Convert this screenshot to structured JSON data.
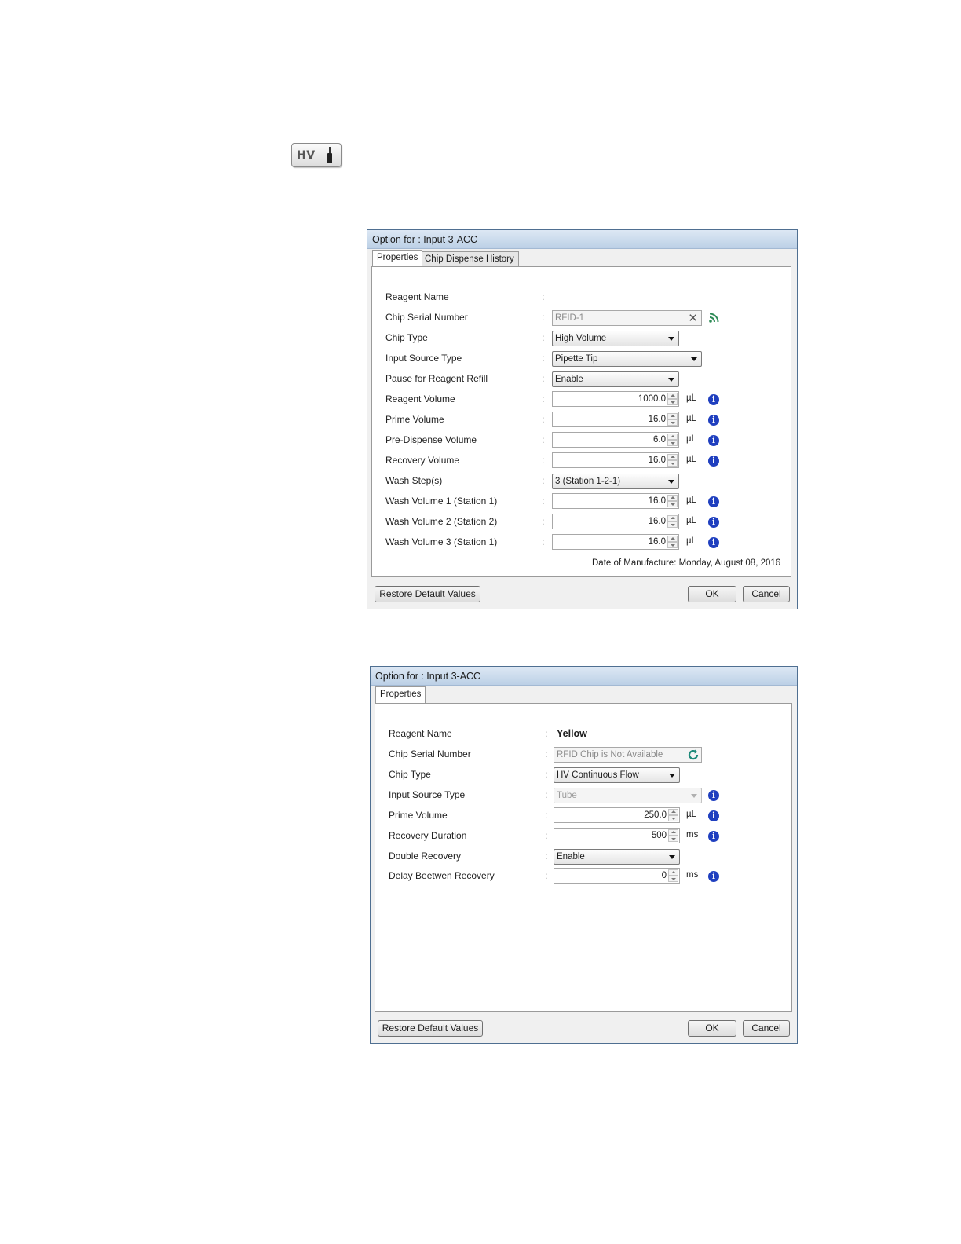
{
  "hv_button": {
    "label": "HV",
    "icon": "tube-icon"
  },
  "dialog1": {
    "title": "Option for : Input 3-ACC",
    "tabs": [
      "Properties",
      "Chip Dispense History"
    ],
    "reagent_name": {
      "label": "Reagent Name",
      "value": ""
    },
    "chip_serial": {
      "label": "Chip Serial Number",
      "value": "RFID-1"
    },
    "chip_type": {
      "label": "Chip Type",
      "value": "High Volume"
    },
    "input_source": {
      "label": "Input Source Type",
      "value": "Pipette Tip"
    },
    "pause_refill": {
      "label": "Pause for Reagent Refill",
      "value": "Enable"
    },
    "reagent_volume": {
      "label": "Reagent Volume",
      "value": "1000.0",
      "unit": "µL"
    },
    "prime_volume": {
      "label": "Prime Volume",
      "value": "16.0",
      "unit": "µL"
    },
    "predispense_volume": {
      "label": "Pre-Dispense Volume",
      "value": "6.0",
      "unit": "µL"
    },
    "recovery_volume": {
      "label": "Recovery Volume",
      "value": "16.0",
      "unit": "µL"
    },
    "wash_steps": {
      "label": "Wash Step(s)",
      "value": "3 (Station 1-2-1)"
    },
    "wash_volume_1": {
      "label": "Wash Volume 1 (Station 1)",
      "value": "16.0",
      "unit": "µL"
    },
    "wash_volume_2": {
      "label": "Wash Volume 2 (Station 2)",
      "value": "16.0",
      "unit": "µL"
    },
    "wash_volume_3": {
      "label": "Wash Volume 3 (Station 1)",
      "value": "16.0",
      "unit": "µL"
    },
    "date_of_manufacture": "Date of Manufacture: Monday, August 08, 2016",
    "buttons": {
      "restore": "Restore Default Values",
      "ok": "OK",
      "cancel": "Cancel"
    }
  },
  "dialog2": {
    "title": "Option for : Input 3-ACC",
    "tabs": [
      "Properties"
    ],
    "reagent_name": {
      "label": "Reagent Name",
      "value": "Yellow"
    },
    "chip_serial": {
      "label": "Chip Serial Number",
      "value": "RFID Chip is Not Available"
    },
    "chip_type": {
      "label": "Chip Type",
      "value": "HV Continuous Flow"
    },
    "input_source": {
      "label": "Input Source Type",
      "value": "Tube"
    },
    "prime_volume": {
      "label": "Prime Volume",
      "value": "250.0",
      "unit": "µL"
    },
    "recovery_duration": {
      "label": "Recovery Duration",
      "value": "500",
      "unit": "ms"
    },
    "double_recovery": {
      "label": "Double Recovery",
      "value": "Enable"
    },
    "delay_between": {
      "label": "Delay Beetwen Recovery",
      "value": "0",
      "unit": "ms"
    },
    "buttons": {
      "restore": "Restore Default Values",
      "ok": "OK",
      "cancel": "Cancel"
    }
  },
  "colon": ":",
  "colors": {
    "titlebar": "#bcd0e6",
    "info": "#1f3fbf",
    "rss": "#2e8b57"
  }
}
